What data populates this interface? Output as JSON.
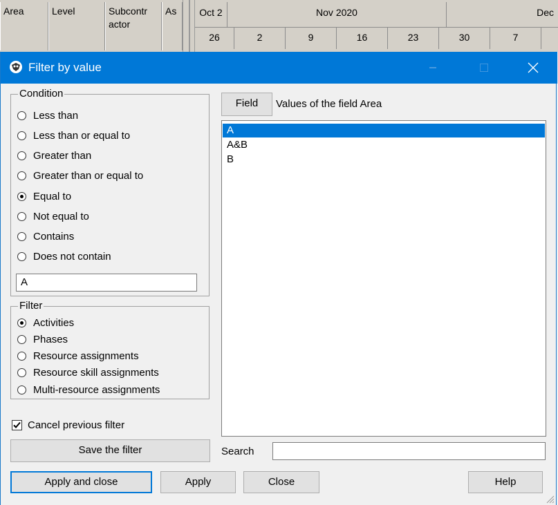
{
  "grid": {
    "columns": [
      "Area",
      "Level",
      "Subcontr actor",
      "As"
    ],
    "months": [
      "Oct 2",
      "Nov 2020",
      "Dec"
    ],
    "days": [
      "26",
      "2",
      "9",
      "16",
      "23",
      "30",
      "7"
    ]
  },
  "dialog": {
    "title": "Filter by value",
    "condition": {
      "legend": "Condition",
      "options": [
        {
          "label": "Less than",
          "selected": false
        },
        {
          "label": "Less than or equal to",
          "selected": false
        },
        {
          "label": "Greater than",
          "selected": false
        },
        {
          "label": "Greater than or equal to",
          "selected": false
        },
        {
          "label": "Equal to",
          "selected": true
        },
        {
          "label": "Not equal to",
          "selected": false
        },
        {
          "label": "Contains",
          "selected": false
        },
        {
          "label": "Does not contain",
          "selected": false
        }
      ],
      "value": "A"
    },
    "filter": {
      "legend": "Filter",
      "options": [
        {
          "label": "Activities",
          "selected": true
        },
        {
          "label": "Phases",
          "selected": false
        },
        {
          "label": "Resource assignments",
          "selected": false
        },
        {
          "label": "Resource skill assignments",
          "selected": false
        },
        {
          "label": "Multi-resource assignments",
          "selected": false
        }
      ]
    },
    "cancel_previous": {
      "label": "Cancel previous filter",
      "checked": true
    },
    "field_button": "Field",
    "values_label": "Values of the field  Area",
    "values": [
      {
        "label": "A",
        "selected": true
      },
      {
        "label": "A&B",
        "selected": false
      },
      {
        "label": "B",
        "selected": false
      }
    ],
    "search_label": "Search",
    "search_value": "",
    "buttons": {
      "save_filter": "Save the filter",
      "apply_close": "Apply and close",
      "apply": "Apply",
      "close": "Close",
      "help": "Help"
    }
  }
}
